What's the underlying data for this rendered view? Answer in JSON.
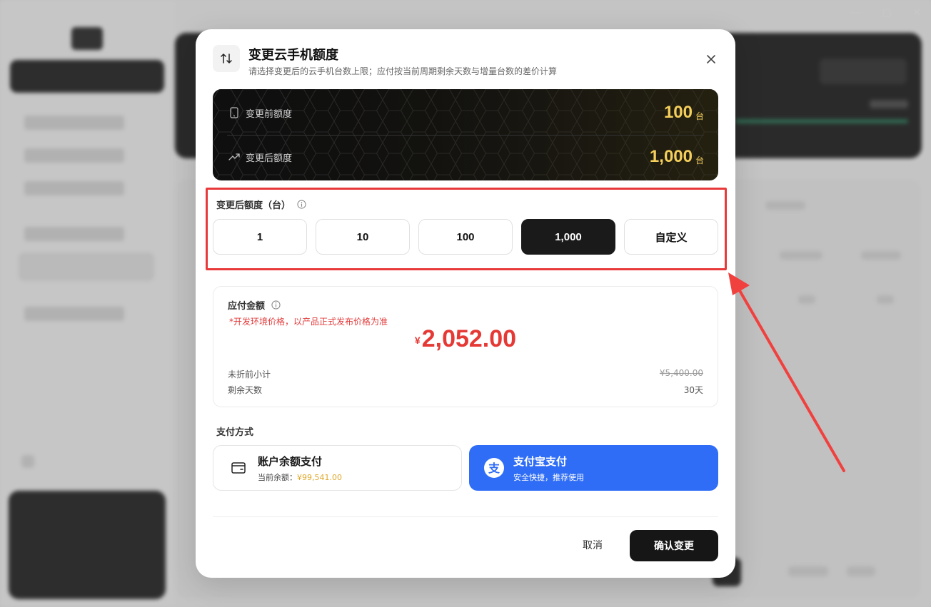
{
  "modal": {
    "title": "变更云手机额度",
    "subtitle": "请选择变更后的云手机台数上限；应付按当前周期剩余天数与增量台数的差价计算"
  },
  "quota": {
    "before_label": "变更前额度",
    "before_value": "100",
    "after_label": "变更后额度",
    "after_value": "1,000",
    "unit": "台"
  },
  "selector": {
    "label": "变更后额度（台）",
    "options": [
      "1",
      "10",
      "100",
      "1,000",
      "自定义"
    ],
    "selected": "1,000"
  },
  "payment": {
    "title": "应付金额",
    "note": "*开发环境价格，以产品正式发布价格为准",
    "currency": "¥",
    "amount": "2,052.00",
    "subtotal_label": "未折前小计",
    "subtotal_value": "¥5,400.00",
    "days_label": "剩余天数",
    "days_value": "30天"
  },
  "methods": {
    "label": "支付方式",
    "balance": {
      "title": "账户余额支付",
      "sub_prefix": "当前余额：",
      "sub_value": "¥99,541.00"
    },
    "alipay": {
      "title": "支付宝支付",
      "sub": "安全快捷，推荐使用"
    }
  },
  "footer": {
    "cancel": "取消",
    "confirm": "确认变更"
  },
  "colors": {
    "accent_gold": "#f5cf5b",
    "price_red": "#e53935",
    "alipay_blue": "#2f6df6",
    "highlight_red": "#e83a3a"
  }
}
